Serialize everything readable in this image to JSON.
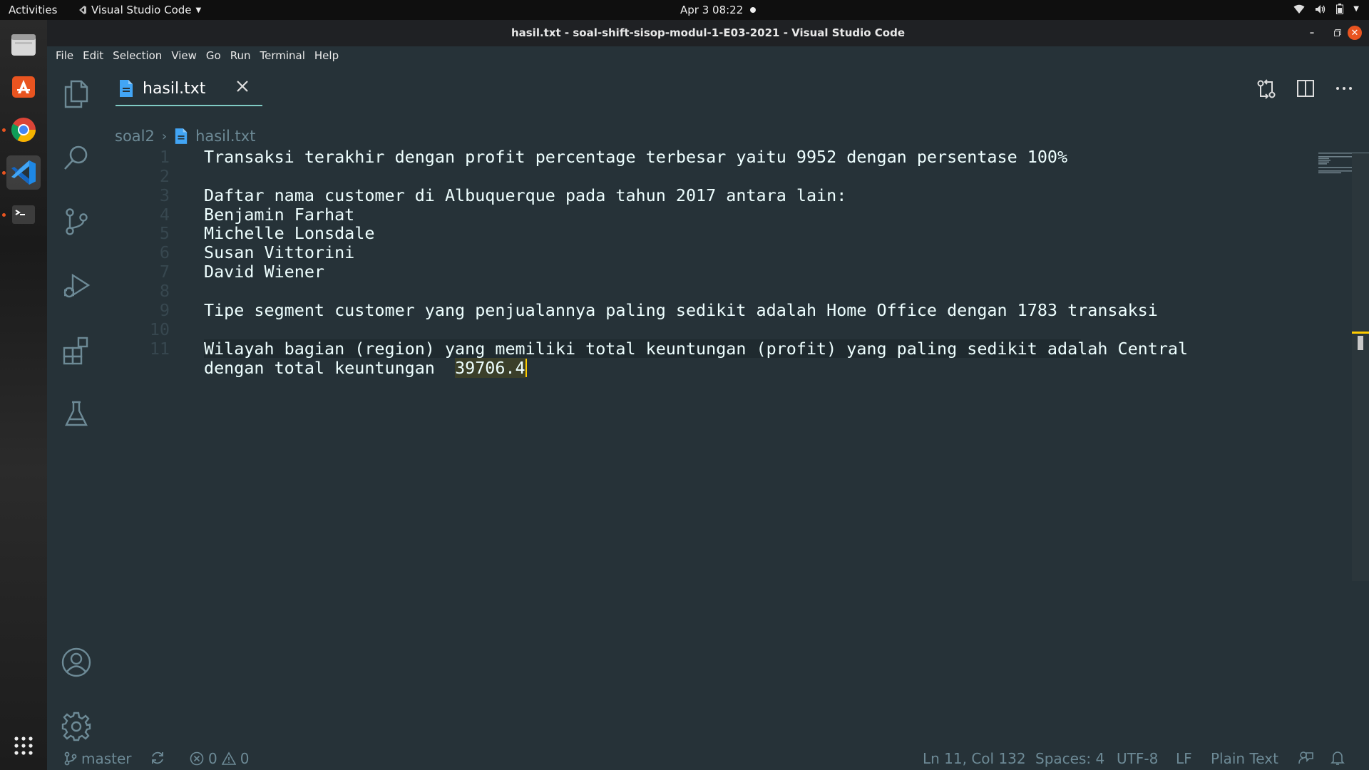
{
  "topbar": {
    "activities": "Activities",
    "app_name": "Visual Studio Code",
    "clock": "Apr 3  08:22"
  },
  "window": {
    "title": "hasil.txt - soal-shift-sisop-modul-1-E03-2021 - Visual Studio Code"
  },
  "menu": [
    "File",
    "Edit",
    "Selection",
    "View",
    "Go",
    "Run",
    "Terminal",
    "Help"
  ],
  "tab": {
    "label": "hasil.txt"
  },
  "breadcrumb": {
    "folder": "soal2",
    "file": "hasil.txt"
  },
  "editor": {
    "lines": [
      "Transaksi terakhir dengan profit percentage terbesar yaitu 9952 dengan persentase 100%",
      "",
      "Daftar nama customer di Albuquerque pada tahun 2017 antara lain:",
      "Benjamin Farhat",
      "Michelle Lonsdale",
      "Susan Vittorini",
      "David Wiener",
      "",
      "Tipe segment customer yang penjualannya paling sedikit adalah Home Office dengan 1783 transaksi",
      "",
      "Wilayah bagian (region) yang memiliki total keuntungan (profit) yang paling sedikit adalah Central"
    ],
    "wrap_prefix": "dengan total keuntungan  ",
    "wrap_value": "39706.4",
    "line_numbers": [
      "1",
      "2",
      "3",
      "4",
      "5",
      "6",
      "7",
      "8",
      "9",
      "10",
      "11"
    ]
  },
  "status": {
    "branch": "master",
    "errors": "0",
    "warnings": "0",
    "position": "Ln 11, Col 132",
    "spaces": "Spaces: 4",
    "encoding": "UTF-8",
    "eol": "LF",
    "language": "Plain Text"
  },
  "colors": {
    "editor_bg": "#263238",
    "accent": "#80cbc4",
    "cursor": "#ffcc00",
    "ubuntu_orange": "#e95420"
  }
}
